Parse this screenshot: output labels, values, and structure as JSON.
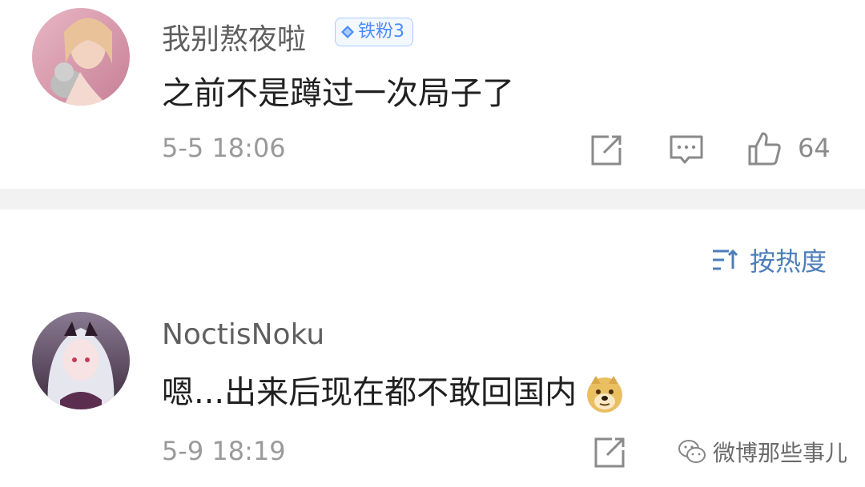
{
  "comments": [
    {
      "username": "我别熬夜啦",
      "badge": "铁粉3",
      "text": "之前不是蹲过一次局子了",
      "time": "5-5 18:06",
      "likes": "64",
      "icons": [
        "share-icon",
        "comment-icon",
        "like-icon"
      ]
    },
    {
      "username": "NoctisNoku",
      "text": "嗯...出来后现在都不敢回国内",
      "time": "5-9 18:19",
      "icons": [
        "share-icon",
        "doge-emoji-icon"
      ]
    }
  ],
  "sort": {
    "label": "按热度",
    "icon": "sort-icon"
  },
  "watermark": {
    "text": "微博那些事儿",
    "icon": "wechat-icon"
  },
  "colors": {
    "badge": "#4a8cff",
    "sort": "#4d7dba",
    "divider": "#f2f2f2"
  }
}
